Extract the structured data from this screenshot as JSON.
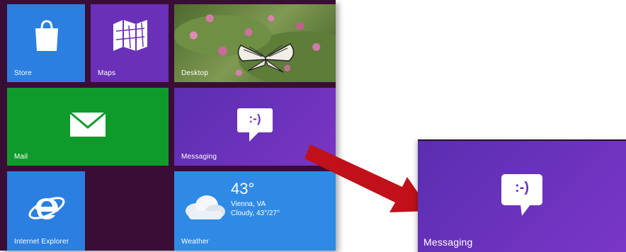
{
  "tiles": {
    "store": {
      "label": "Store",
      "icon": "shopping-bag-icon"
    },
    "maps": {
      "label": "Maps",
      "icon": "map-icon"
    },
    "desktop": {
      "label": "Desktop"
    },
    "mail": {
      "label": "Mail",
      "icon": "envelope-icon"
    },
    "messaging": {
      "label": "Messaging",
      "icon": "smiley-bubble-icon",
      "emoticon": ":-)"
    },
    "internet_explorer": {
      "label": "Internet Explorer",
      "icon": "ie-logo-icon"
    },
    "weather": {
      "label": "Weather",
      "temperature": "43°",
      "location": "Vienna, VA",
      "condition": "Cloudy, 43°/27°"
    }
  },
  "zoomed_tile": {
    "label": "Messaging",
    "emoticon": ":-)"
  },
  "colors": {
    "start_background": "#3a0d36",
    "store": "#2b7fe0",
    "maps": "#6a30b8",
    "mail": "#0f9b2c",
    "messaging": "#6a32bc",
    "ie": "#2b7fe0",
    "weather": "#2f8ae6",
    "arrow": "#c0101a"
  }
}
